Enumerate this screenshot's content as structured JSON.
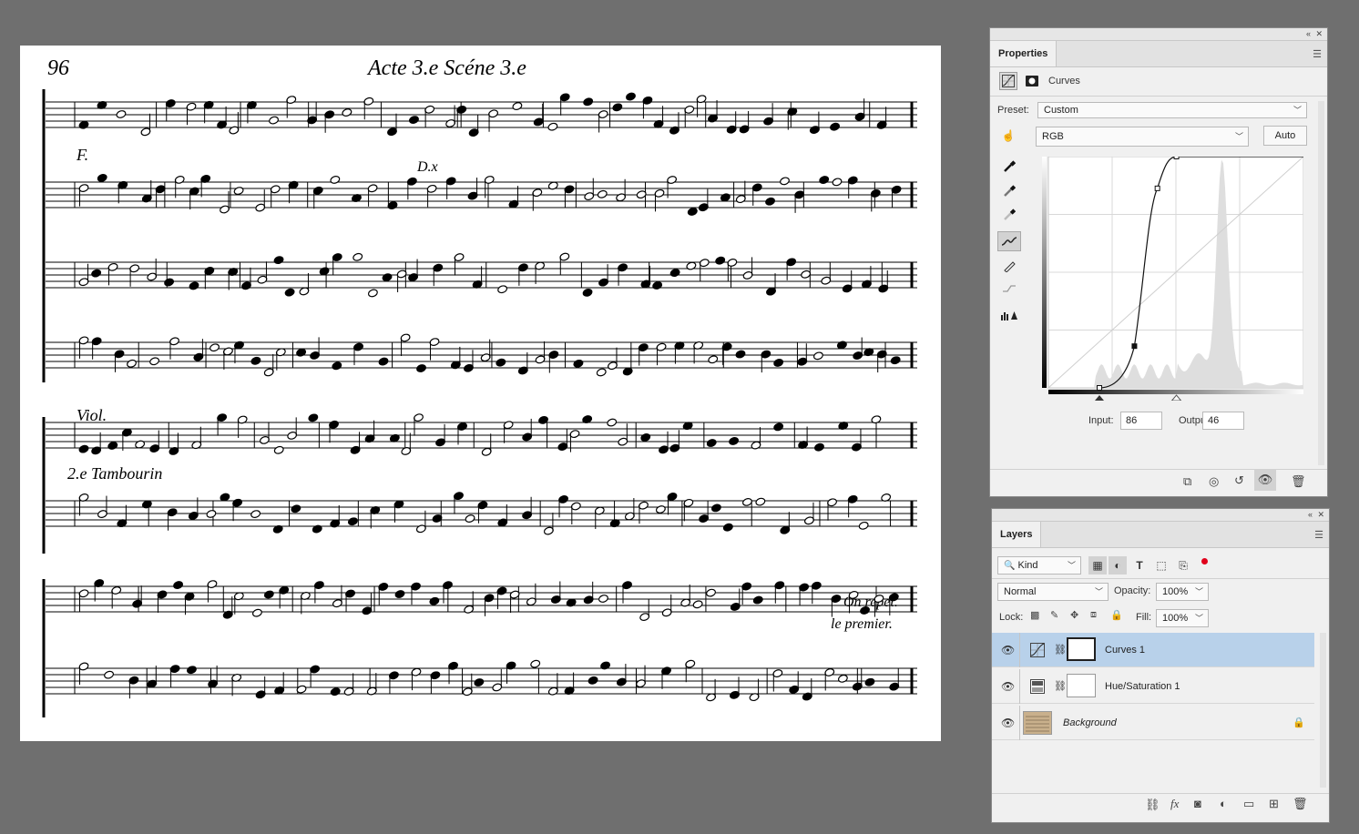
{
  "document": {
    "page_number": "96",
    "heading": "Acte 3.e Scéne 3.e",
    "score_labels": {
      "dynamic_f": "F.",
      "dessus": "D.x",
      "viol": "Viol.",
      "tambourin": "2.e Tambourin",
      "on_repete": "On repet.",
      "le_premier": "le premier."
    }
  },
  "properties_panel": {
    "tab_title": "Properties",
    "adjustment_name": "Curves",
    "preset_label": "Preset:",
    "preset_value": "Custom",
    "channel_value": "RGB",
    "auto_button": "Auto",
    "input_label": "Input:",
    "input_value": "86",
    "output_label": "Output:",
    "output_value": "46"
  },
  "layers_panel": {
    "tab_title": "Layers",
    "filter_kind": "Kind",
    "blend_mode": "Normal",
    "opacity_label": "Opacity:",
    "opacity_value": "100%",
    "lock_label": "Lock:",
    "fill_label": "Fill:",
    "fill_value": "100%",
    "layers": [
      {
        "name": "Curves 1",
        "selected": true,
        "icon": "curves-adjustment-icon"
      },
      {
        "name": "Hue/Saturation 1",
        "selected": false,
        "icon": "hue-saturation-adjustment-icon"
      },
      {
        "name": "Background",
        "selected": false,
        "icon": "image-thumbnail",
        "locked": true
      }
    ]
  },
  "colors": {
    "workspace_bg": "#6f6f6f",
    "panel_bg": "#f0f0f0",
    "selected_layer": "#b8d1ea",
    "filter_dot": "#e0001b"
  }
}
